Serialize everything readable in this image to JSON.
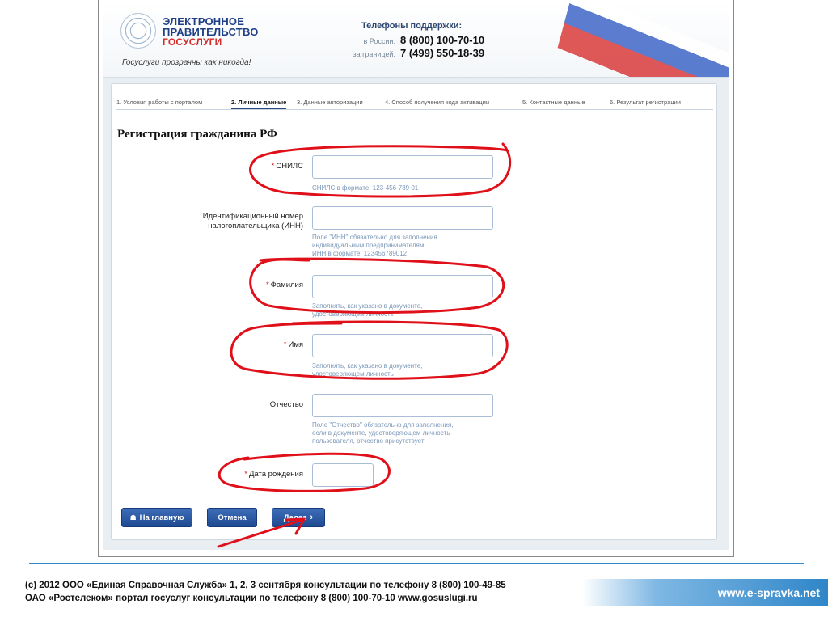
{
  "header": {
    "logo_line1": "ЭЛЕКТРОННОЕ",
    "logo_line2": "ПРАВИТЕЛЬСТВО",
    "logo_line3": "ГОСУСЛУГИ",
    "slogan": "Госуслуги прозрачны как никогда!",
    "support_title": "Телефоны поддержки:",
    "russia_label": "в России:",
    "russia_phone": "8 (800) 100-70-10",
    "abroad_label": "за границей:",
    "abroad_phone": "7 (499) 550-18-39"
  },
  "steps": [
    {
      "label": "1. Условия работы с порталом",
      "active": false
    },
    {
      "label": "2. Личные данные",
      "active": true
    },
    {
      "label": "3. Данные авторизации",
      "active": false
    },
    {
      "label": "4. Способ получения кода активации",
      "active": false
    },
    {
      "label": "5. Контактные данные",
      "active": false
    },
    {
      "label": "6. Результат регистрации",
      "active": false
    }
  ],
  "form": {
    "title": "Регистрация гражданина РФ",
    "required_mark": "*",
    "snils": {
      "label": "СНИЛС",
      "value": "",
      "hint": "СНИЛС в формате: 123-456-789 01"
    },
    "inn": {
      "label_line1": "Идентификационный номер",
      "label_line2": "налогоплательщика (ИНН)",
      "value": "",
      "hint_line1": "Поле \"ИНН\" обязательно для заполнения",
      "hint_line2": "индивидуальным предпринимателям.",
      "hint_line3": "ИНН в формате: 123456789012"
    },
    "surname": {
      "label": "Фамилия",
      "value": "",
      "hint_line1": "Заполнять, как указано в документе,",
      "hint_line2": "удостоверяющем личность"
    },
    "name": {
      "label": "Имя",
      "value": "",
      "hint_line1": "Заполнять, как указано в документе,",
      "hint_line2": "удостоверяющем личность"
    },
    "patronymic": {
      "label": "Отчество",
      "value": "",
      "hint_line1": "Поле \"Отчество\" обязательно для заполнения,",
      "hint_line2": "если в документе, удостоверяющем личность",
      "hint_line3": "пользователя, отчество присутствует"
    },
    "birthdate": {
      "label": "Дата рождения",
      "value": ""
    }
  },
  "buttons": {
    "home": "На главную",
    "cancel": "Отмена",
    "next": "Далее"
  },
  "icons": {
    "home": "home-icon",
    "next": "chevron-right-icon"
  },
  "colors": {
    "brand_blue": "#1e4a91",
    "required_red": "#d31f1f",
    "annotation_red": "#e0101a",
    "footer_blue": "#2f86c8"
  },
  "footer": {
    "line1": "(с) 2012 ООО «Единая Справочная Служба»  1, 2, 3 сентября консультации по телефону 8 (800) 100-49-85",
    "line2": "ОАО «Ростелеком» портал госуслуг консультации по телефону 8 (800) 100-70-10 www.gosuslugi.ru",
    "site": "www.e-spravka.net"
  }
}
